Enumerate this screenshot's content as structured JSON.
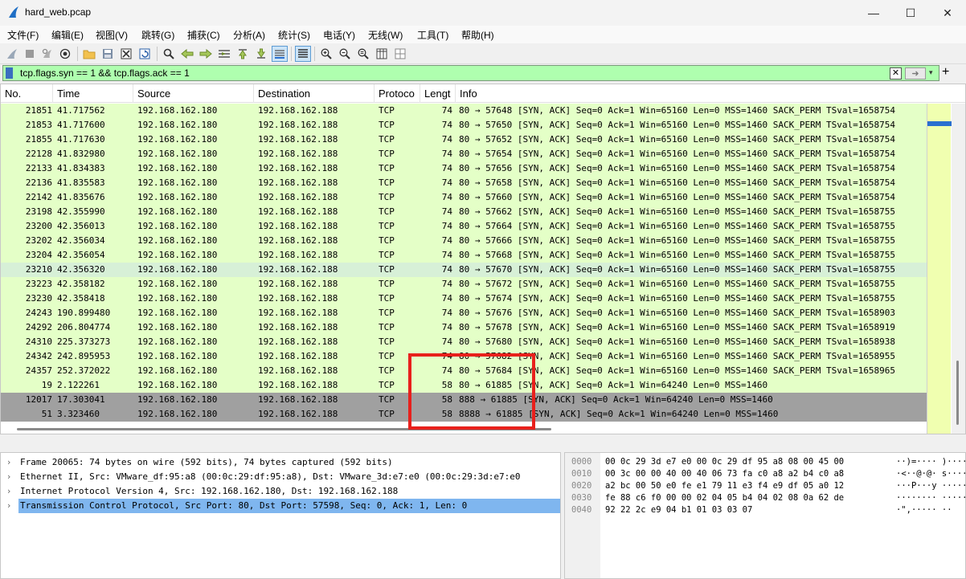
{
  "window": {
    "title": "hard_web.pcap",
    "controls": {
      "minimize": "—",
      "maximize": "☐",
      "close": "✕"
    }
  },
  "menu": [
    "文件(F)",
    "编辑(E)",
    "视图(V)",
    "跳转(G)",
    "捕获(C)",
    "分析(A)",
    "统计(S)",
    "电话(Y)",
    "无线(W)",
    "工具(T)",
    "帮助(H)"
  ],
  "toolbar": {
    "icons": [
      "shark-fin-start-icon",
      "stop-icon",
      "restart-icon",
      "capture-options-icon",
      "open-folder-icon",
      "save-icon",
      "close-file-icon",
      "reload-icon",
      "find-icon",
      "back-icon",
      "forward-icon",
      "go-to-packet-icon",
      "first-packet-icon",
      "last-packet-icon",
      "autoscroll-icon",
      "colorize-icon",
      "zoom-in-icon",
      "zoom-out-icon",
      "normal-size-icon",
      "resize-columns-icon",
      "layout-icon"
    ]
  },
  "filter": {
    "value": "tcp.flags.syn == 1 && tcp.flags.ack == 1",
    "clear_label": "✕",
    "apply_label": "➜",
    "dropdown_label": "▾",
    "add_label": "+"
  },
  "columns": [
    "No.",
    "Time",
    "Source",
    "Destination",
    "Protoco",
    "Lengt",
    "Info"
  ],
  "packets": [
    {
      "no": "21851",
      "time": "41.717562",
      "src": "192.168.162.180",
      "dst": "192.168.162.188",
      "proto": "TCP",
      "len": "74",
      "info": "80 → 57648 [SYN, ACK] Seq=0 Ack=1 Win=65160 Len=0 MSS=1460 SACK_PERM TSval=1658754"
    },
    {
      "no": "21853",
      "time": "41.717600",
      "src": "192.168.162.180",
      "dst": "192.168.162.188",
      "proto": "TCP",
      "len": "74",
      "info": "80 → 57650 [SYN, ACK] Seq=0 Ack=1 Win=65160 Len=0 MSS=1460 SACK_PERM TSval=1658754"
    },
    {
      "no": "21855",
      "time": "41.717630",
      "src": "192.168.162.180",
      "dst": "192.168.162.188",
      "proto": "TCP",
      "len": "74",
      "info": "80 → 57652 [SYN, ACK] Seq=0 Ack=1 Win=65160 Len=0 MSS=1460 SACK_PERM TSval=1658754"
    },
    {
      "no": "22128",
      "time": "41.832980",
      "src": "192.168.162.180",
      "dst": "192.168.162.188",
      "proto": "TCP",
      "len": "74",
      "info": "80 → 57654 [SYN, ACK] Seq=0 Ack=1 Win=65160 Len=0 MSS=1460 SACK_PERM TSval=1658754"
    },
    {
      "no": "22133",
      "time": "41.834383",
      "src": "192.168.162.180",
      "dst": "192.168.162.188",
      "proto": "TCP",
      "len": "74",
      "info": "80 → 57656 [SYN, ACK] Seq=0 Ack=1 Win=65160 Len=0 MSS=1460 SACK_PERM TSval=1658754"
    },
    {
      "no": "22136",
      "time": "41.835583",
      "src": "192.168.162.180",
      "dst": "192.168.162.188",
      "proto": "TCP",
      "len": "74",
      "info": "80 → 57658 [SYN, ACK] Seq=0 Ack=1 Win=65160 Len=0 MSS=1460 SACK_PERM TSval=1658754"
    },
    {
      "no": "22142",
      "time": "41.835676",
      "src": "192.168.162.180",
      "dst": "192.168.162.188",
      "proto": "TCP",
      "len": "74",
      "info": "80 → 57660 [SYN, ACK] Seq=0 Ack=1 Win=65160 Len=0 MSS=1460 SACK_PERM TSval=1658754"
    },
    {
      "no": "23198",
      "time": "42.355990",
      "src": "192.168.162.180",
      "dst": "192.168.162.188",
      "proto": "TCP",
      "len": "74",
      "info": "80 → 57662 [SYN, ACK] Seq=0 Ack=1 Win=65160 Len=0 MSS=1460 SACK_PERM TSval=1658755"
    },
    {
      "no": "23200",
      "time": "42.356013",
      "src": "192.168.162.180",
      "dst": "192.168.162.188",
      "proto": "TCP",
      "len": "74",
      "info": "80 → 57664 [SYN, ACK] Seq=0 Ack=1 Win=65160 Len=0 MSS=1460 SACK_PERM TSval=1658755"
    },
    {
      "no": "23202",
      "time": "42.356034",
      "src": "192.168.162.180",
      "dst": "192.168.162.188",
      "proto": "TCP",
      "len": "74",
      "info": "80 → 57666 [SYN, ACK] Seq=0 Ack=1 Win=65160 Len=0 MSS=1460 SACK_PERM TSval=1658755"
    },
    {
      "no": "23204",
      "time": "42.356054",
      "src": "192.168.162.180",
      "dst": "192.168.162.188",
      "proto": "TCP",
      "len": "74",
      "info": "80 → 57668 [SYN, ACK] Seq=0 Ack=1 Win=65160 Len=0 MSS=1460 SACK_PERM TSval=1658755"
    },
    {
      "no": "23210",
      "time": "42.356320",
      "src": "192.168.162.180",
      "dst": "192.168.162.188",
      "proto": "TCP",
      "len": "74",
      "info": "80 → 57670 [SYN, ACK] Seq=0 Ack=1 Win=65160 Len=0 MSS=1460 SACK_PERM TSval=1658755"
    },
    {
      "no": "23223",
      "time": "42.358182",
      "src": "192.168.162.180",
      "dst": "192.168.162.188",
      "proto": "TCP",
      "len": "74",
      "info": "80 → 57672 [SYN, ACK] Seq=0 Ack=1 Win=65160 Len=0 MSS=1460 SACK_PERM TSval=1658755"
    },
    {
      "no": "23230",
      "time": "42.358418",
      "src": "192.168.162.180",
      "dst": "192.168.162.188",
      "proto": "TCP",
      "len": "74",
      "info": "80 → 57674 [SYN, ACK] Seq=0 Ack=1 Win=65160 Len=0 MSS=1460 SACK_PERM TSval=1658755"
    },
    {
      "no": "24243",
      "time": "190.899480",
      "src": "192.168.162.180",
      "dst": "192.168.162.188",
      "proto": "TCP",
      "len": "74",
      "info": "80 → 57676 [SYN, ACK] Seq=0 Ack=1 Win=65160 Len=0 MSS=1460 SACK_PERM TSval=1658903"
    },
    {
      "no": "24292",
      "time": "206.804774",
      "src": "192.168.162.180",
      "dst": "192.168.162.188",
      "proto": "TCP",
      "len": "74",
      "info": "80 → 57678 [SYN, ACK] Seq=0 Ack=1 Win=65160 Len=0 MSS=1460 SACK_PERM TSval=1658919"
    },
    {
      "no": "24310",
      "time": "225.373273",
      "src": "192.168.162.180",
      "dst": "192.168.162.188",
      "proto": "TCP",
      "len": "74",
      "info": "80 → 57680 [SYN, ACK] Seq=0 Ack=1 Win=65160 Len=0 MSS=1460 SACK_PERM TSval=1658938"
    },
    {
      "no": "24342",
      "time": "242.895953",
      "src": "192.168.162.180",
      "dst": "192.168.162.188",
      "proto": "TCP",
      "len": "74",
      "info": "80 → 57682 [SYN, ACK] Seq=0 Ack=1 Win=65160 Len=0 MSS=1460 SACK_PERM TSval=1658955"
    },
    {
      "no": "24357",
      "time": "252.372022",
      "src": "192.168.162.180",
      "dst": "192.168.162.188",
      "proto": "TCP",
      "len": "74",
      "info": "80 → 57684 [SYN, ACK] Seq=0 Ack=1 Win=65160 Len=0 MSS=1460 SACK_PERM TSval=1658965"
    },
    {
      "no": "19",
      "time": "2.122261",
      "src": "192.168.162.180",
      "dst": "192.168.162.188",
      "proto": "TCP",
      "len": "58",
      "info": "80 → 61885 [SYN, ACK] Seq=0 Ack=1 Win=64240 Len=0 MSS=1460"
    },
    {
      "no": "12017",
      "time": "17.303041",
      "src": "192.168.162.180",
      "dst": "192.168.162.188",
      "proto": "TCP",
      "len": "58",
      "info": "888 → 61885 [SYN, ACK] Seq=0 Ack=1 Win=64240 Len=0 MSS=1460"
    },
    {
      "no": "51",
      "time": "3.323460",
      "src": "192.168.162.180",
      "dst": "192.168.162.188",
      "proto": "TCP",
      "len": "58",
      "info": "8888 → 61885 [SYN, ACK] Seq=0 Ack=1 Win=64240 Len=0 MSS=1460"
    }
  ],
  "colors": {
    "row_green": "#e4ffc7",
    "row_selected_ref": "#d7f0d7",
    "row_gray": "#a0a0a0",
    "filter_ok": "#afffaf",
    "detail_selected": "#7fb6ef",
    "highlight": "#e8201c"
  },
  "details": [
    {
      "text": "Frame 20065: 74 bytes on wire (592 bits), 74 bytes captured (592 bits)",
      "selected": false
    },
    {
      "text": "Ethernet II, Src: VMware_df:95:a8 (00:0c:29:df:95:a8), Dst: VMware_3d:e7:e0 (00:0c:29:3d:e7:e0",
      "selected": false
    },
    {
      "text": "Internet Protocol Version 4, Src: 192.168.162.180, Dst: 192.168.162.188",
      "selected": false
    },
    {
      "text": "Transmission Control Protocol, Src Port: 80, Dst Port: 57598, Seq: 0, Ack: 1, Len: 0",
      "selected": true
    }
  ],
  "bytes": [
    {
      "offset": "0000",
      "hex": "00 0c 29 3d e7 e0 00 0c  29 df 95 a8 08 00 45 00",
      "ascii": "··)=····  )·····E·"
    },
    {
      "offset": "0010",
      "hex": "00 3c 00 00 40 00 40 06  73 fa c0 a8 a2 b4 c0 a8",
      "ascii": "·<··@·@·  s·······"
    },
    {
      "offset": "0020",
      "hex": "a2 bc 00 50 e0 fe e1 79  11 e3 f4 e9 df 05 a0 12",
      "ascii": "···P···y  ········"
    },
    {
      "offset": "0030",
      "hex": "fe 88 c6 f0 00 00 02 04  05 b4 04 02 08 0a 62 de",
      "ascii": "········  ······b·"
    },
    {
      "offset": "0040",
      "hex": "92 22 2c e9 04 b1 01 03  03 07",
      "ascii": "·\",·····  ··"
    }
  ]
}
